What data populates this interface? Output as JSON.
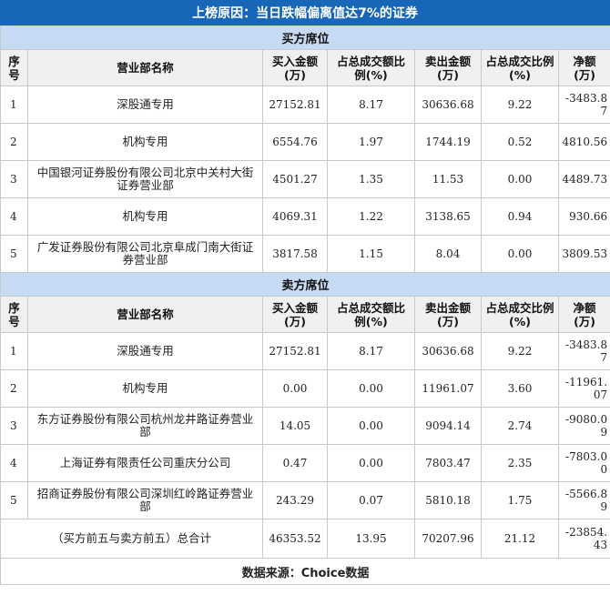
{
  "title": "上榜原因：当日跌幅偏离值达7%的证券",
  "columns": [
    "序号",
    "营业部名称",
    "买入金额(万)",
    "占总成交额比例(%)",
    "卖出金额(万)",
    "占总成交比例(%)",
    "净额(万)"
  ],
  "buy_section": {
    "label": "买方席位",
    "rows": [
      {
        "idx": "1",
        "name": "深股通专用",
        "buy": "27152.81",
        "buy_pct": "8.17",
        "sell": "30636.68",
        "sell_pct": "9.22",
        "net": "-3483.87"
      },
      {
        "idx": "2",
        "name": "机构专用",
        "buy": "6554.76",
        "buy_pct": "1.97",
        "sell": "1744.19",
        "sell_pct": "0.52",
        "net": "4810.56"
      },
      {
        "idx": "3",
        "name": "中国银河证券股份有限公司北京中关村大街证券营业部",
        "buy": "4501.27",
        "buy_pct": "1.35",
        "sell": "11.53",
        "sell_pct": "0.00",
        "net": "4489.73"
      },
      {
        "idx": "4",
        "name": "机构专用",
        "buy": "4069.31",
        "buy_pct": "1.22",
        "sell": "3138.65",
        "sell_pct": "0.94",
        "net": "930.66"
      },
      {
        "idx": "5",
        "name": "广发证券股份有限公司北京阜成门南大街证券营业部",
        "buy": "3817.58",
        "buy_pct": "1.15",
        "sell": "8.04",
        "sell_pct": "0.00",
        "net": "3809.53"
      }
    ]
  },
  "sell_section": {
    "label": "卖方席位",
    "rows": [
      {
        "idx": "1",
        "name": "深股通专用",
        "buy": "27152.81",
        "buy_pct": "8.17",
        "sell": "30636.68",
        "sell_pct": "9.22",
        "net": "-3483.87"
      },
      {
        "idx": "2",
        "name": "机构专用",
        "buy": "0.00",
        "buy_pct": "0.00",
        "sell": "11961.07",
        "sell_pct": "3.60",
        "net": "-11961.07"
      },
      {
        "idx": "3",
        "name": "东方证券股份有限公司杭州龙井路证券营业部",
        "buy": "14.05",
        "buy_pct": "0.00",
        "sell": "9094.14",
        "sell_pct": "2.74",
        "net": "-9080.09"
      },
      {
        "idx": "4",
        "name": "上海证券有限责任公司重庆分公司",
        "buy": "0.47",
        "buy_pct": "0.00",
        "sell": "7803.47",
        "sell_pct": "2.35",
        "net": "-7803.00"
      },
      {
        "idx": "5",
        "name": "招商证券股份有限公司深圳红岭路证券营业部",
        "buy": "243.29",
        "buy_pct": "0.07",
        "sell": "5810.18",
        "sell_pct": "1.75",
        "net": "-5566.89"
      }
    ],
    "total": {
      "name": "（买方前五与卖方前五）总合计",
      "buy": "46353.52",
      "buy_pct": "13.95",
      "sell": "70207.96",
      "sell_pct": "21.12",
      "net": "-23854.43"
    }
  },
  "footer": "数据来源：Choice数据",
  "colors": {
    "title_bg": "#1766b8",
    "section_bg": "#c7daf3",
    "header_bg": "#f0f0f0",
    "border": "#c9c9c9"
  }
}
